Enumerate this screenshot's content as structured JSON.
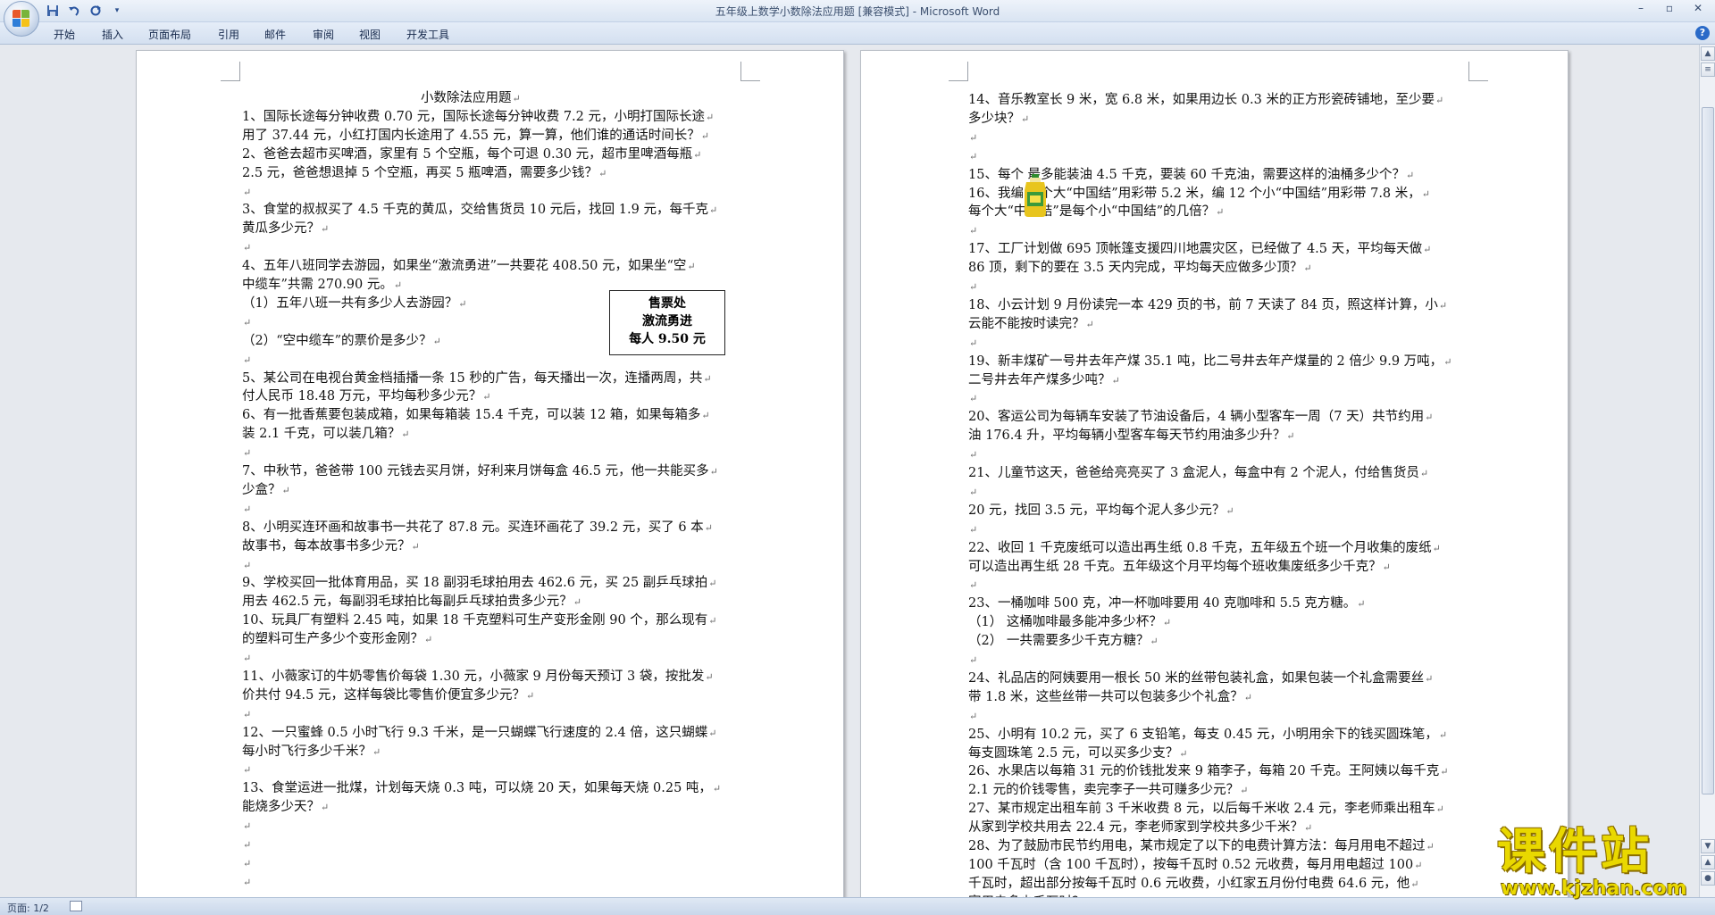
{
  "window": {
    "title": "五年级上数学小数除法应用题 [兼容模式] - Microsoft Word",
    "controls": [
      "–",
      "▫",
      "✕"
    ]
  },
  "qat": {
    "save_icon": "save-icon",
    "undo_icon": "undo-icon",
    "redo_icon": "redo-icon",
    "customize_icon": "customize-icon"
  },
  "tabs": [
    "开始",
    "插入",
    "页面布局",
    "引用",
    "邮件",
    "审阅",
    "视图",
    "开发工具"
  ],
  "help": "?",
  "status": {
    "page": "页面: 1/2"
  },
  "ticket": {
    "line1": "售票处",
    "line2": "激流勇进",
    "line3": "每人 9.50 元"
  },
  "watermark": {
    "main": "课件站",
    "url": "www.kjzhan.com"
  },
  "left_lines": [
    "小数除法应用题",
    "1、国际长途每分钟收费 0.70 元，国际长途每分钟收费 7.2 元，小明打国际长途",
    "用了 37.44 元，小红打国内长途用了 4.55 元，算一算，他们谁的通话时间长？",
    "2、爸爸去超市买啤酒，家里有 5 个空瓶，每个可退 0.30 元，超市里啤酒每瓶",
    "2.5 元，爸爸想退掉 5 个空瓶，再买 5 瓶啤酒，需要多少钱？",
    "",
    "3、食堂的叔叔买了 4.5 千克的黄瓜，交给售货员 10 元后，找回 1.9 元，每千克",
    "黄瓜多少元？",
    "",
    "4、五年八班同学去游园，如果坐“激流勇进”一共要花 408.50 元，如果坐“空",
    "中缆车”共需 270.90 元。",
    "（1）五年八班一共有多少人去游园？",
    "",
    "（2）“空中缆车”的票价是多少？",
    "",
    "5、某公司在电视台黄金档插播一条 15 秒的广告，每天播出一次，连播两周，共",
    "付人民币 18.48 万元，平均每秒多少元？",
    "6、有一批香蕉要包装成箱，如果每箱装 15.4 千克，可以装 12 箱，如果每箱多",
    "装 2.1 千克，可以装几箱？",
    "",
    "7、中秋节，爸爸带 100 元钱去买月饼，好利来月饼每盒 46.5 元，他一共能买多",
    "少盒？",
    "",
    "8、小明买连环画和故事书一共花了 87.8 元。买连环画花了 39.2 元，买了 6 本",
    "故事书，每本故事书多少元？",
    "",
    "9、学校买回一批体育用品，买 18 副羽毛球拍用去 462.6 元，买 25 副乒乓球拍",
    "用去 462.5 元，每副羽毛球拍比每副乒乓球拍贵多少元？",
    "10、玩具厂有塑料 2.45 吨，如果 18 千克塑料可生产变形金刚 90 个，那么现有",
    "的塑料可生产多少个变形金刚？",
    "",
    "11、小薇家订的牛奶零售价每袋 1.30 元，小薇家 9 月份每天预订 3 袋，按批发",
    "价共付 94.5 元，这样每袋比零售价便宜多少元？",
    "",
    "12、一只蜜蜂 0.5 小时飞行 9.3 千米，是一只蝴蝶飞行速度的 2.4 倍，这只蝴蝶",
    "每小时飞行多少千米？",
    "",
    "13、食堂运进一批煤，计划每天烧 0.3 吨，可以烧 20 天，如果每天烧 0.25 吨，",
    "能烧多少天？",
    "",
    "",
    "",
    ""
  ],
  "right_lines": [
    "14、音乐教室长 9 米，宽 6.8 米，如果用边长 0.3 米的正方形瓷砖铺地，至少要",
    "多少块？",
    "",
    "",
    "15、每个        最多能装油 4.5 千克，要装 60 千克油，需要这样的油桶多少个？",
    "16、我编 4 个大“中国结”用彩带 5.2 米，编 12 个小“中国结”用彩带 7.8 米，",
    "每个大“中国结”是每个小“中国结”的几倍？",
    "",
    "17、工厂计划做 695 顶帐篷支援四川地震灾区，已经做了 4.5 天，平均每天做",
    "86 顶，剩下的要在 3.5 天内完成，平均每天应做多少顶？",
    "",
    "18、小云计划 9 月份读完一本 429 页的书，前 7 天读了 84 页，照这样计算，小",
    "云能不能按时读完？",
    "",
    "19、新丰煤矿一号井去年产煤 35.1 吨，比二号井去年产煤量的 2 倍少 9.9 万吨，",
    "二号井去年产煤多少吨？",
    "",
    "20、客运公司为每辆车安装了节油设备后，4 辆小型客车一周（7 天）共节约用",
    "油 176.4 升，平均每辆小型客车每天节约用油多少升？",
    "",
    "21、儿童节这天，爸爸给亮亮买了 3 盒泥人，每盒中有 2 个泥人，付给售货员",
    "",
    "    20 元，找回 3.5 元，平均每个泥人多少元？",
    "",
    "22、收回 1 千克废纸可以造出再生纸 0.8 千克，五年级五个班一个月收集的废纸",
    "    可以造出再生纸 28 千克。五年级这个月平均每个班收集废纸多少千克？",
    "",
    "23、一桶咖啡 500 克，冲一杯咖啡要用 40 克咖啡和 5.5 克方糖。",
    "（1）  这桶咖啡最多能冲多少杯？",
    "（2）  一共需要多少千克方糖？",
    "",
    "24、礼品店的阿姨要用一根长 50 米的丝带包装礼盒，如果包装一个礼盒需要丝",
    "    带 1.8 米，这些丝带一共可以包装多少个礼盒？",
    "",
    "25、小明有 10.2 元，买了 6 支铅笔，每支 0.45 元，小明用余下的钱买圆珠笔，",
    "    每支圆珠笔 2.5 元，可以买多少支？",
    "26、水果店以每箱 31 元的价钱批发来 9 箱李子，每箱 20 千克。王阿姨以每千克",
    "    2.1 元的价钱零售，卖完李子一共可赚多少元？",
    "27、某市规定出租车前 3 千米收费 8 元，以后每千米收 2.4 元，李老师乘出租车",
    "    从家到学校共用去 22.4 元，李老师家到学校共多少千米？",
    "28、为了鼓励市民节约用电，某市规定了以下的电费计算方法：每月用电不超过",
    "    100 千瓦时（含 100 千瓦时），按每千瓦时 0.52 元收费，每月用电超过 100",
    "    千瓦时，超出部分按每千瓦时 0.6 元收费，小红家五月份付电费 64.6 元，他",
    "    家用电多少千瓦时？"
  ]
}
